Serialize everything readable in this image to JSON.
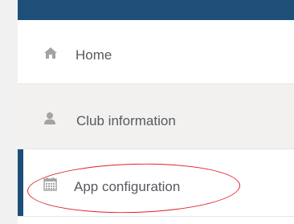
{
  "sidebar": {
    "items": [
      {
        "label": "Home",
        "icon": "home-icon"
      },
      {
        "label": "Club information",
        "icon": "user-icon"
      },
      {
        "label": "App configuration",
        "icon": "calendar-icon",
        "active": true
      }
    ]
  },
  "colors": {
    "top_bar": "#1d4f79",
    "active_indicator": "#1d4f79",
    "hover_row": "#f3f1f0",
    "icon": "#a3a3a3",
    "text": "#555a5f",
    "annotation": "#e0202a"
  }
}
